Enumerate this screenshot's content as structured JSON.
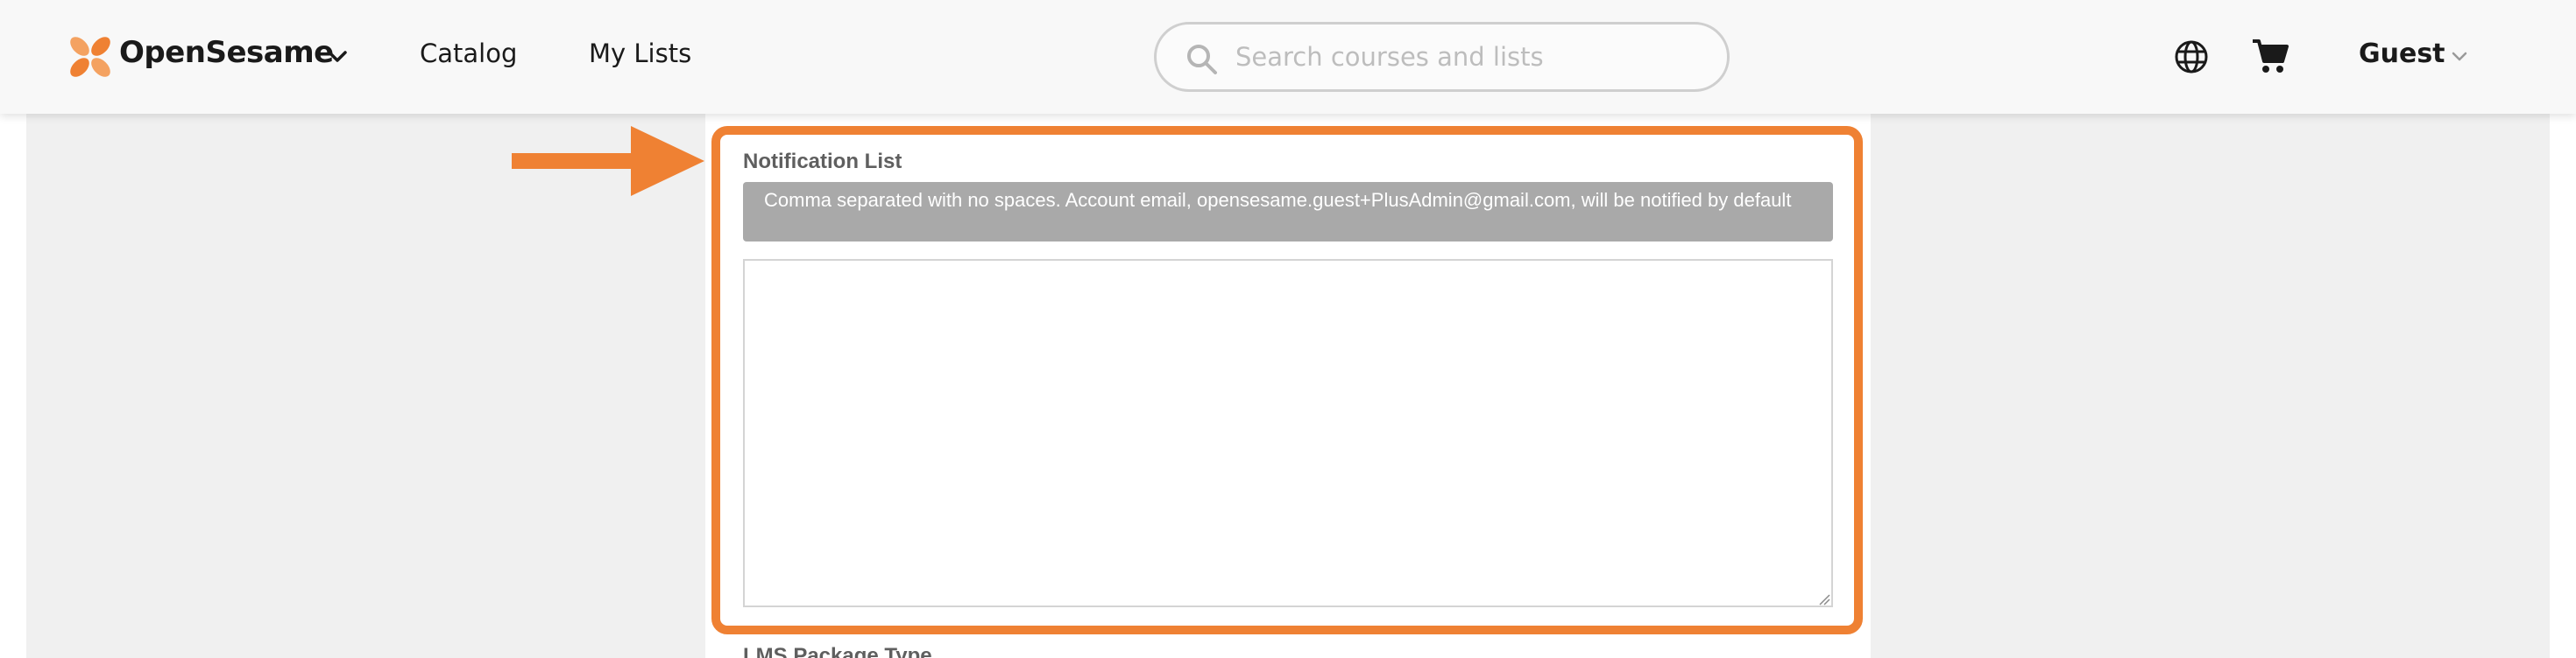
{
  "header": {
    "brand": "OpenSesame",
    "nav": {
      "catalog": "Catalog",
      "my_lists": "My Lists"
    },
    "search": {
      "placeholder": "Search courses and lists",
      "value": ""
    },
    "icons": [
      "logo-icon",
      "chevron-down-icon",
      "search-icon",
      "globe-icon",
      "cart-icon"
    ],
    "user": "Guest"
  },
  "form": {
    "notification_list": {
      "label": "Notification List",
      "help": "Comma separated with no spaces. Account email, opensesame.guest+PlusAdmin@gmail.com, will be notified by default",
      "value": ""
    },
    "next_label": "LMS Package Type"
  },
  "colors": {
    "accent": "#ef8133",
    "help_bg": "#a9a9a9",
    "page_bg": "#f0f0f0"
  }
}
